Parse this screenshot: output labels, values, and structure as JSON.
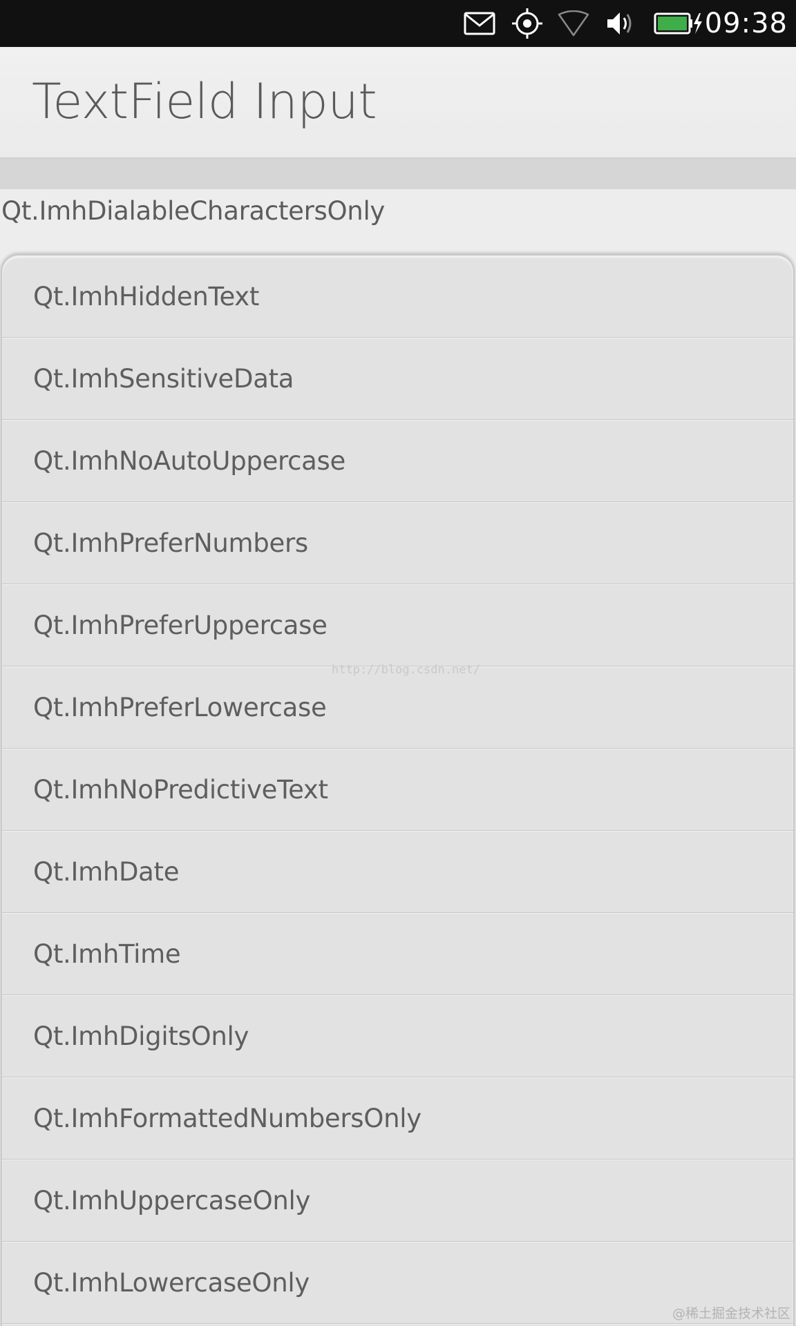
{
  "status_bar": {
    "time": "09:38",
    "icons": [
      "mail-icon",
      "location-icon",
      "wifi-icon",
      "volume-icon",
      "battery-charging-icon"
    ],
    "battery_color": "#3fae49"
  },
  "header": {
    "title": "TextField Input"
  },
  "textfield": {
    "value": "Qt.ImhDialableCharactersOnly"
  },
  "options": [
    {
      "label": "Qt.ImhHiddenText"
    },
    {
      "label": "Qt.ImhSensitiveData"
    },
    {
      "label": "Qt.ImhNoAutoUppercase"
    },
    {
      "label": "Qt.ImhPreferNumbers"
    },
    {
      "label": "Qt.ImhPreferUppercase"
    },
    {
      "label": "Qt.ImhPreferLowercase"
    },
    {
      "label": "Qt.ImhNoPredictiveText"
    },
    {
      "label": "Qt.ImhDate"
    },
    {
      "label": "Qt.ImhTime"
    },
    {
      "label": "Qt.ImhDigitsOnly"
    },
    {
      "label": "Qt.ImhFormattedNumbersOnly"
    },
    {
      "label": "Qt.ImhUppercaseOnly"
    },
    {
      "label": "Qt.ImhLowercaseOnly"
    }
  ],
  "watermarks": {
    "center": "http://blog.csdn.net/",
    "corner": "@稀土掘金技术社区"
  }
}
